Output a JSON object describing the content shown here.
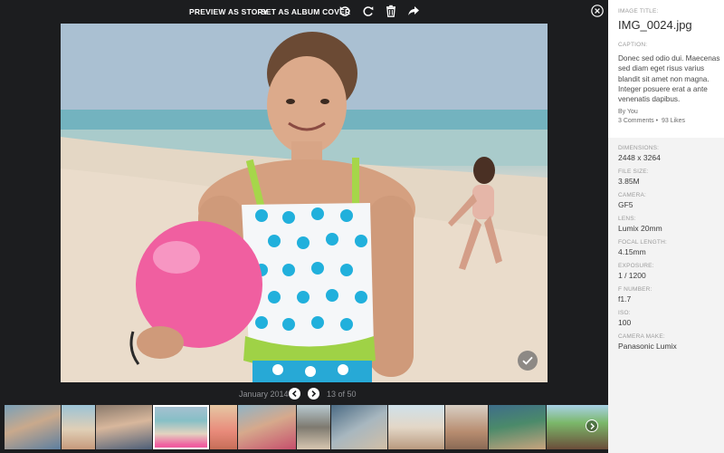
{
  "toolbar": {
    "preview_label": "PREVIEW AS STORY",
    "album_cover_label": "SET AS ALBUM COVER"
  },
  "pager": {
    "date": "January 2014",
    "count": "13 of 50"
  },
  "details": {
    "title_label": "IMAGE TITLE:",
    "title": "IMG_0024.jpg",
    "caption_label": "CAPTION:",
    "caption": "Donec sed odio dui. Maecenas sed diam eget risus varius blandit sit amet non magna. Integer posuere erat a ante venenatis dapibus.",
    "by": "By You",
    "comments": "3 Comments",
    "likes": "93 Likes",
    "dimensions_label": "DIMENSIONS:",
    "dimensions": "2448 x 3264",
    "file_size_label": "FILE SIZE:",
    "file_size": "3.85M",
    "camera_label": "CAMERA:",
    "camera": "GF5",
    "lens_label": "LENS:",
    "lens": "Lumix 20mm",
    "focal_label": "FOCAL LENGTH:",
    "focal": "4.15mm",
    "exposure_label": "EXPOSURE:",
    "exposure": "1 / 1200",
    "fnumber_label": "F NUMBER:",
    "fnumber": "f1.7",
    "iso_label": "ISO:",
    "iso": "100",
    "make_label": "CAMERA MAKE:",
    "make": "Panasonic Lumix"
  },
  "icons": [
    "rotate-left-icon",
    "rotate-right-icon",
    "trash-icon",
    "share-icon",
    "close-icon",
    "check-icon",
    "chevron-left-icon",
    "chevron-right-icon"
  ],
  "colors": {
    "background": "#1c1d1f",
    "panel": "#f3f3f3",
    "accent": "#ffffff"
  }
}
